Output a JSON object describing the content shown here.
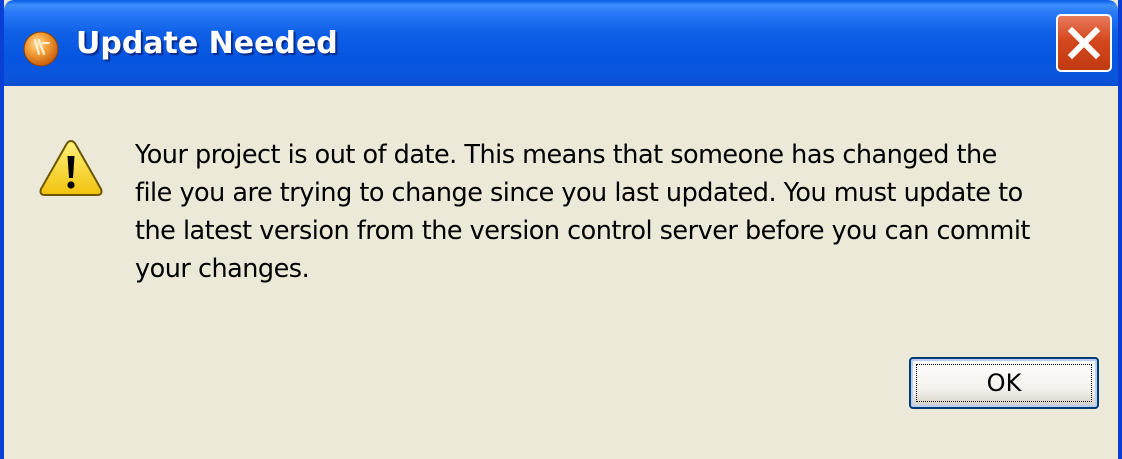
{
  "window": {
    "title": "Update Needed",
    "title_icon": "eclipse-logo-icon",
    "close_icon": "close-icon"
  },
  "message": {
    "icon": "warning-icon",
    "lines": [
      "Your project is out of date.  This means that someone has changed the",
      "file you are trying to change since you last updated.  You must update to",
      "the latest version from the version control server before you can commit",
      "your changes."
    ]
  },
  "buttons": {
    "ok_label": "OK"
  },
  "colors": {
    "titlebar": "#0a5ce8",
    "dialog_background": "#ece9d8",
    "close_button": "#d4481e",
    "warning_fill": "#f7d51e"
  }
}
